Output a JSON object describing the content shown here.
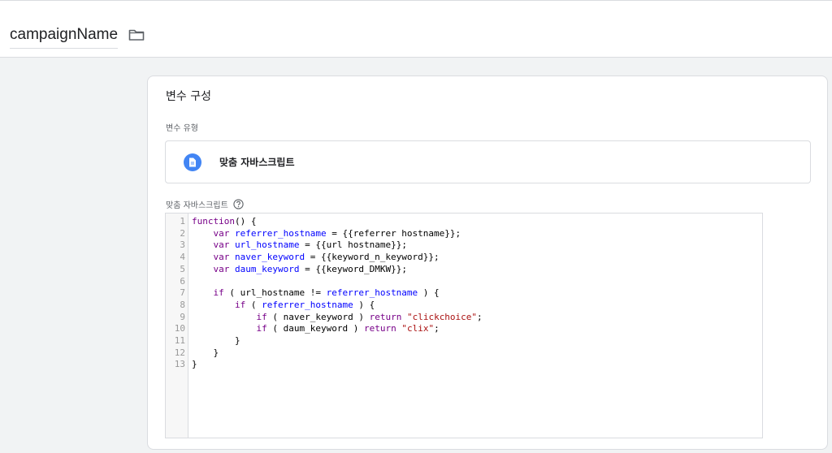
{
  "header": {
    "title": "campaignName",
    "folder_icon": "folder-icon"
  },
  "card": {
    "title": "변수 구성",
    "type_label": "변수 유형",
    "type_name": "맞춤 자바스크립트",
    "type_icon": "document-icon",
    "editor_label": "맞춤 자바스크립트",
    "help_icon": "help-icon"
  },
  "editor": {
    "line_numbers": [
      "1",
      "2",
      "3",
      "4",
      "5",
      "6",
      "7",
      "8",
      "9",
      "10",
      "11",
      "12",
      "13"
    ],
    "lines": [
      [
        {
          "t": "function",
          "c": "kw"
        },
        {
          "t": "() {",
          "c": ""
        }
      ],
      [
        {
          "t": "    ",
          "c": ""
        },
        {
          "t": "var",
          "c": "kw"
        },
        {
          "t": " ",
          "c": ""
        },
        {
          "t": "referrer_hostname",
          "c": "def"
        },
        {
          "t": " = {{referrer hostname}};",
          "c": ""
        }
      ],
      [
        {
          "t": "    ",
          "c": ""
        },
        {
          "t": "var",
          "c": "kw"
        },
        {
          "t": " ",
          "c": ""
        },
        {
          "t": "url_hostname",
          "c": "def"
        },
        {
          "t": " = {{url hostname}};",
          "c": ""
        }
      ],
      [
        {
          "t": "    ",
          "c": ""
        },
        {
          "t": "var",
          "c": "kw"
        },
        {
          "t": " ",
          "c": ""
        },
        {
          "t": "naver_keyword",
          "c": "def"
        },
        {
          "t": " = {{keyword_n_keyword}};",
          "c": ""
        }
      ],
      [
        {
          "t": "    ",
          "c": ""
        },
        {
          "t": "var",
          "c": "kw"
        },
        {
          "t": " ",
          "c": ""
        },
        {
          "t": "daum_keyword",
          "c": "def"
        },
        {
          "t": " = {{keyword_DMKW}};",
          "c": ""
        }
      ],
      [
        {
          "t": "",
          "c": ""
        }
      ],
      [
        {
          "t": "    ",
          "c": ""
        },
        {
          "t": "if",
          "c": "kw"
        },
        {
          "t": " ( url_hostname != ",
          "c": ""
        },
        {
          "t": "referrer_hostname",
          "c": "def"
        },
        {
          "t": " ) {",
          "c": ""
        }
      ],
      [
        {
          "t": "        ",
          "c": ""
        },
        {
          "t": "if",
          "c": "kw"
        },
        {
          "t": " ( ",
          "c": ""
        },
        {
          "t": "referrer_hostname",
          "c": "def"
        },
        {
          "t": " ) {",
          "c": ""
        }
      ],
      [
        {
          "t": "            ",
          "c": ""
        },
        {
          "t": "if",
          "c": "kw"
        },
        {
          "t": " ( naver_keyword ) ",
          "c": ""
        },
        {
          "t": "return",
          "c": "kw"
        },
        {
          "t": " ",
          "c": ""
        },
        {
          "t": "\"clickchoice\"",
          "c": "str"
        },
        {
          "t": ";",
          "c": ""
        }
      ],
      [
        {
          "t": "            ",
          "c": ""
        },
        {
          "t": "if",
          "c": "kw"
        },
        {
          "t": " ( daum_keyword ) ",
          "c": ""
        },
        {
          "t": "return",
          "c": "kw"
        },
        {
          "t": " ",
          "c": ""
        },
        {
          "t": "\"clix\"",
          "c": "str"
        },
        {
          "t": ";",
          "c": ""
        }
      ],
      [
        {
          "t": "        }",
          "c": ""
        }
      ],
      [
        {
          "t": "    }",
          "c": ""
        }
      ],
      [
        {
          "t": "}",
          "c": ""
        }
      ]
    ]
  },
  "colors": {
    "keyword": "#770088",
    "variable_def": "#0000ff",
    "string": "#aa1111",
    "icon_blue": "#4285f4"
  }
}
